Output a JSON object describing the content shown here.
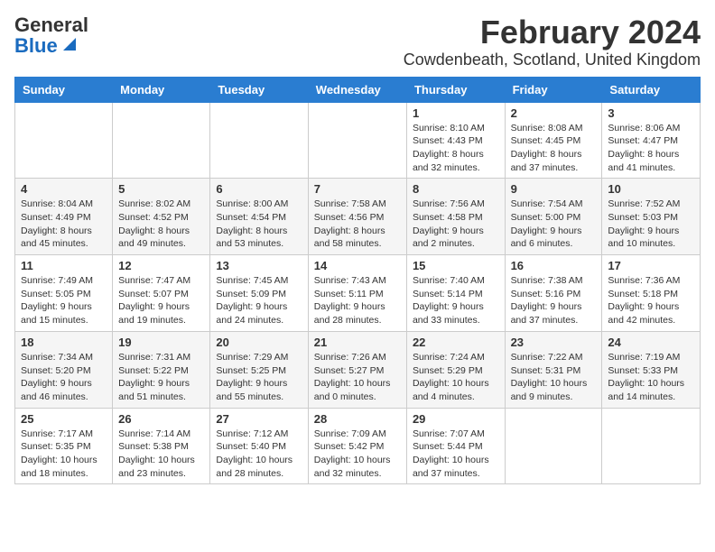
{
  "logo": {
    "line1": "General",
    "line2": "Blue"
  },
  "title": "February 2024",
  "subtitle": "Cowdenbeath, Scotland, United Kingdom",
  "weekdays": [
    "Sunday",
    "Monday",
    "Tuesday",
    "Wednesday",
    "Thursday",
    "Friday",
    "Saturday"
  ],
  "weeks": [
    [
      {
        "day": "",
        "info": ""
      },
      {
        "day": "",
        "info": ""
      },
      {
        "day": "",
        "info": ""
      },
      {
        "day": "",
        "info": ""
      },
      {
        "day": "1",
        "info": "Sunrise: 8:10 AM\nSunset: 4:43 PM\nDaylight: 8 hours\nand 32 minutes."
      },
      {
        "day": "2",
        "info": "Sunrise: 8:08 AM\nSunset: 4:45 PM\nDaylight: 8 hours\nand 37 minutes."
      },
      {
        "day": "3",
        "info": "Sunrise: 8:06 AM\nSunset: 4:47 PM\nDaylight: 8 hours\nand 41 minutes."
      }
    ],
    [
      {
        "day": "4",
        "info": "Sunrise: 8:04 AM\nSunset: 4:49 PM\nDaylight: 8 hours\nand 45 minutes."
      },
      {
        "day": "5",
        "info": "Sunrise: 8:02 AM\nSunset: 4:52 PM\nDaylight: 8 hours\nand 49 minutes."
      },
      {
        "day": "6",
        "info": "Sunrise: 8:00 AM\nSunset: 4:54 PM\nDaylight: 8 hours\nand 53 minutes."
      },
      {
        "day": "7",
        "info": "Sunrise: 7:58 AM\nSunset: 4:56 PM\nDaylight: 8 hours\nand 58 minutes."
      },
      {
        "day": "8",
        "info": "Sunrise: 7:56 AM\nSunset: 4:58 PM\nDaylight: 9 hours\nand 2 minutes."
      },
      {
        "day": "9",
        "info": "Sunrise: 7:54 AM\nSunset: 5:00 PM\nDaylight: 9 hours\nand 6 minutes."
      },
      {
        "day": "10",
        "info": "Sunrise: 7:52 AM\nSunset: 5:03 PM\nDaylight: 9 hours\nand 10 minutes."
      }
    ],
    [
      {
        "day": "11",
        "info": "Sunrise: 7:49 AM\nSunset: 5:05 PM\nDaylight: 9 hours\nand 15 minutes."
      },
      {
        "day": "12",
        "info": "Sunrise: 7:47 AM\nSunset: 5:07 PM\nDaylight: 9 hours\nand 19 minutes."
      },
      {
        "day": "13",
        "info": "Sunrise: 7:45 AM\nSunset: 5:09 PM\nDaylight: 9 hours\nand 24 minutes."
      },
      {
        "day": "14",
        "info": "Sunrise: 7:43 AM\nSunset: 5:11 PM\nDaylight: 9 hours\nand 28 minutes."
      },
      {
        "day": "15",
        "info": "Sunrise: 7:40 AM\nSunset: 5:14 PM\nDaylight: 9 hours\nand 33 minutes."
      },
      {
        "day": "16",
        "info": "Sunrise: 7:38 AM\nSunset: 5:16 PM\nDaylight: 9 hours\nand 37 minutes."
      },
      {
        "day": "17",
        "info": "Sunrise: 7:36 AM\nSunset: 5:18 PM\nDaylight: 9 hours\nand 42 minutes."
      }
    ],
    [
      {
        "day": "18",
        "info": "Sunrise: 7:34 AM\nSunset: 5:20 PM\nDaylight: 9 hours\nand 46 minutes."
      },
      {
        "day": "19",
        "info": "Sunrise: 7:31 AM\nSunset: 5:22 PM\nDaylight: 9 hours\nand 51 minutes."
      },
      {
        "day": "20",
        "info": "Sunrise: 7:29 AM\nSunset: 5:25 PM\nDaylight: 9 hours\nand 55 minutes."
      },
      {
        "day": "21",
        "info": "Sunrise: 7:26 AM\nSunset: 5:27 PM\nDaylight: 10 hours\nand 0 minutes."
      },
      {
        "day": "22",
        "info": "Sunrise: 7:24 AM\nSunset: 5:29 PM\nDaylight: 10 hours\nand 4 minutes."
      },
      {
        "day": "23",
        "info": "Sunrise: 7:22 AM\nSunset: 5:31 PM\nDaylight: 10 hours\nand 9 minutes."
      },
      {
        "day": "24",
        "info": "Sunrise: 7:19 AM\nSunset: 5:33 PM\nDaylight: 10 hours\nand 14 minutes."
      }
    ],
    [
      {
        "day": "25",
        "info": "Sunrise: 7:17 AM\nSunset: 5:35 PM\nDaylight: 10 hours\nand 18 minutes."
      },
      {
        "day": "26",
        "info": "Sunrise: 7:14 AM\nSunset: 5:38 PM\nDaylight: 10 hours\nand 23 minutes."
      },
      {
        "day": "27",
        "info": "Sunrise: 7:12 AM\nSunset: 5:40 PM\nDaylight: 10 hours\nand 28 minutes."
      },
      {
        "day": "28",
        "info": "Sunrise: 7:09 AM\nSunset: 5:42 PM\nDaylight: 10 hours\nand 32 minutes."
      },
      {
        "day": "29",
        "info": "Sunrise: 7:07 AM\nSunset: 5:44 PM\nDaylight: 10 hours\nand 37 minutes."
      },
      {
        "day": "",
        "info": ""
      },
      {
        "day": "",
        "info": ""
      }
    ]
  ]
}
